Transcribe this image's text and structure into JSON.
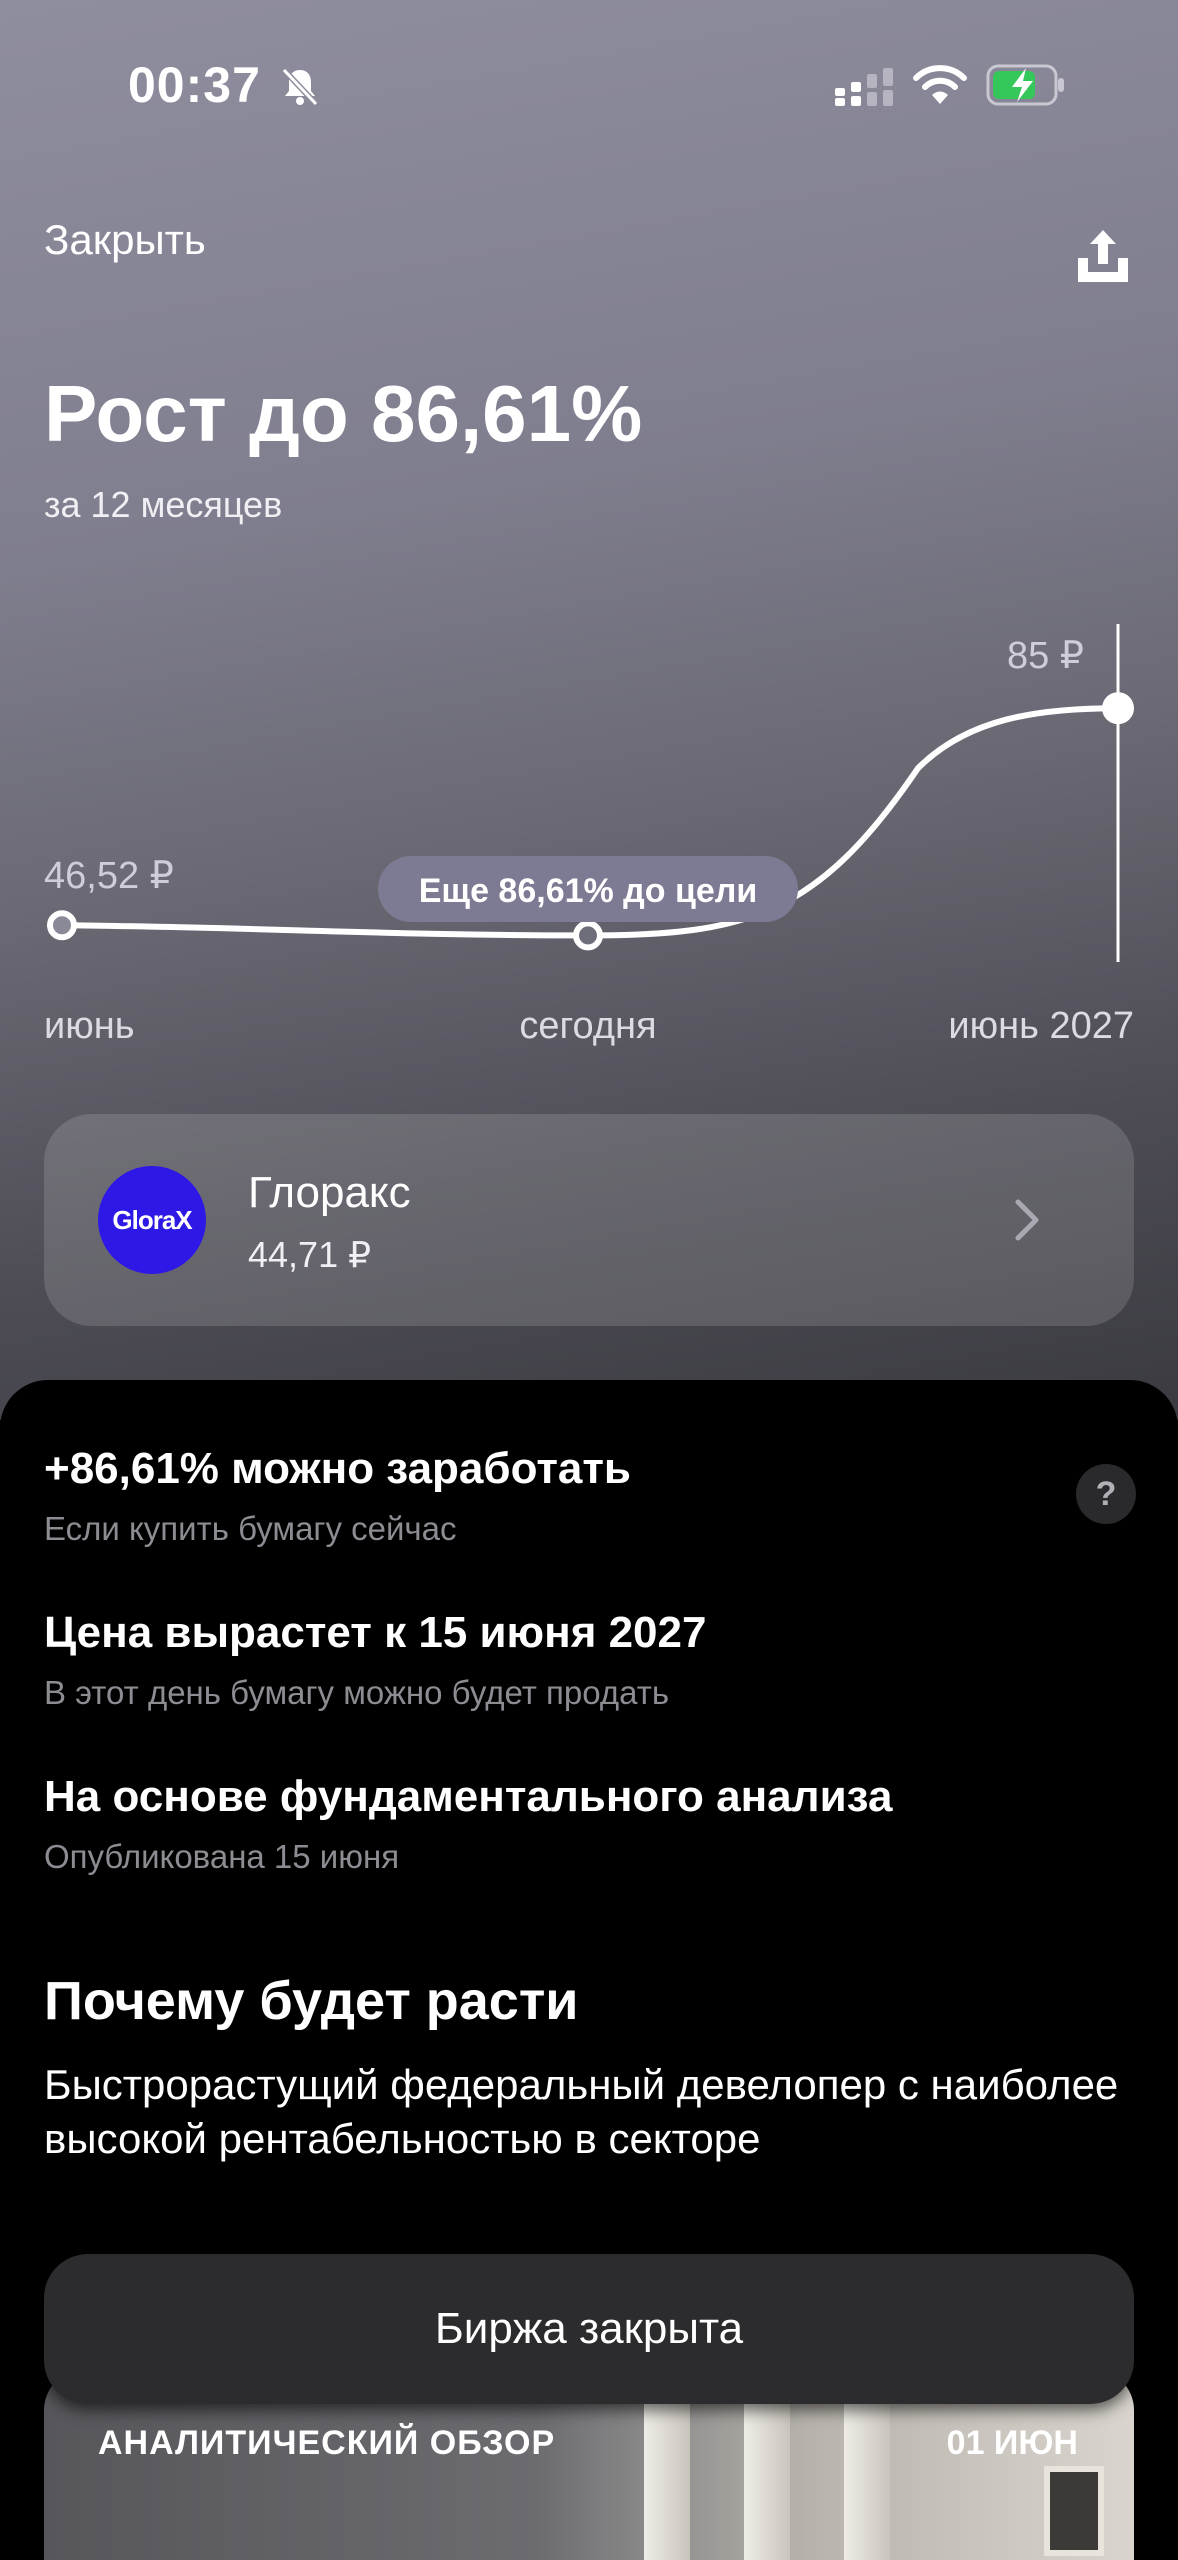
{
  "status_bar": {
    "time": "00:37"
  },
  "header": {
    "close_label": "Закрыть"
  },
  "hero": {
    "title": "Рост до 86,61%",
    "subtitle": "за 12 месяцев"
  },
  "chart_data": {
    "type": "line",
    "x": [
      "июнь",
      "сегодня",
      "июнь 2027"
    ],
    "series": [
      {
        "values": [
          46.52,
          44.71,
          85
        ]
      }
    ],
    "x_tick_labels": [
      "июнь",
      "сегодня",
      "июнь 2027"
    ],
    "value_labels": {
      "start": "46,52 ₽",
      "end": "85 ₽"
    },
    "annotation": "Еще 86,61% до цели"
  },
  "instrument": {
    "name": "Глоракс",
    "price": "44,71 ₽",
    "logo_text": "GloraX",
    "logo_color": "#2d18e6"
  },
  "details": [
    {
      "title": "+86,61% можно заработать",
      "subtitle": "Если купить бумагу сейчас"
    },
    {
      "title": "Цена вырастет к 15 июня 2027",
      "subtitle": "В этот день бумагу можно будет продать"
    },
    {
      "title": "На основе фундаментального анализа",
      "subtitle": "Опубликована 15 июня"
    }
  ],
  "help": {
    "icon": "question-icon",
    "glyph": "?"
  },
  "why": {
    "title": "Почему будет расти",
    "text": "Быстрорастущий федеральный девелопер с наиболее высокой рентабельностью в секторе"
  },
  "action": {
    "label": "Биржа закрыта"
  },
  "review": {
    "label": "АНАЛИТИЧЕСКИЙ ОБЗОР",
    "date": "01 ИЮН"
  }
}
